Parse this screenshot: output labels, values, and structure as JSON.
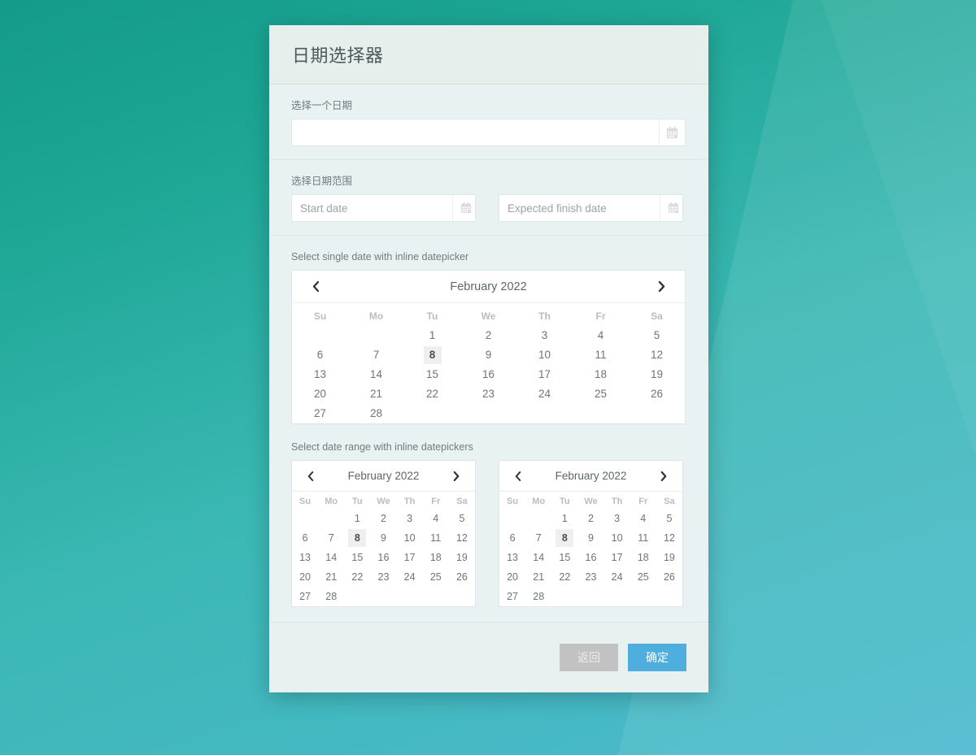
{
  "theme": {
    "bg_gradient_from": "#149b8a",
    "bg_gradient_to": "#4cb9cf",
    "modal_bg": "#e9f2f1",
    "header_bg": "#e7efed",
    "accent": "#4eaede",
    "muted_button": "#c2c2c2",
    "selected_day_bg": "#efefef"
  },
  "modal": {
    "title": "日期选择器"
  },
  "single_field": {
    "label": "选择一个日期",
    "value": "",
    "placeholder": "",
    "icon": "calendar-icon"
  },
  "range_field": {
    "label": "选择日期范围",
    "start": {
      "value": "",
      "placeholder": "Start date",
      "icon": "calendar-icon"
    },
    "end": {
      "value": "",
      "placeholder": "Expected finish date",
      "icon": "calendar-icon"
    }
  },
  "inline_single": {
    "label": "Select single date with inline datepicker",
    "picker": {
      "month_title": "February 2022",
      "prev_icon": "chevron-left-icon",
      "next_icon": "chevron-right-icon",
      "weekdays": [
        "Su",
        "Mo",
        "Tu",
        "We",
        "Th",
        "Fr",
        "Sa"
      ],
      "weeks": [
        [
          "",
          "",
          "1",
          "2",
          "3",
          "4",
          "5"
        ],
        [
          "6",
          "7",
          "8",
          "9",
          "10",
          "11",
          "12"
        ],
        [
          "13",
          "14",
          "15",
          "16",
          "17",
          "18",
          "19"
        ],
        [
          "20",
          "21",
          "22",
          "23",
          "24",
          "25",
          "26"
        ],
        [
          "27",
          "28",
          "",
          "",
          "",
          "",
          ""
        ]
      ],
      "selected": "8"
    }
  },
  "inline_range": {
    "label": "Select date range with inline datepickers",
    "start_picker": {
      "month_title": "February 2022",
      "prev_icon": "chevron-left-icon",
      "next_icon": "chevron-right-icon",
      "weekdays": [
        "Su",
        "Mo",
        "Tu",
        "We",
        "Th",
        "Fr",
        "Sa"
      ],
      "weeks": [
        [
          "",
          "",
          "1",
          "2",
          "3",
          "4",
          "5"
        ],
        [
          "6",
          "7",
          "8",
          "9",
          "10",
          "11",
          "12"
        ],
        [
          "13",
          "14",
          "15",
          "16",
          "17",
          "18",
          "19"
        ],
        [
          "20",
          "21",
          "22",
          "23",
          "24",
          "25",
          "26"
        ],
        [
          "27",
          "28",
          "",
          "",
          "",
          "",
          ""
        ]
      ],
      "selected": "8"
    },
    "end_picker": {
      "month_title": "February 2022",
      "prev_icon": "chevron-left-icon",
      "next_icon": "chevron-right-icon",
      "weekdays": [
        "Su",
        "Mo",
        "Tu",
        "We",
        "Th",
        "Fr",
        "Sa"
      ],
      "weeks": [
        [
          "",
          "",
          "1",
          "2",
          "3",
          "4",
          "5"
        ],
        [
          "6",
          "7",
          "8",
          "9",
          "10",
          "11",
          "12"
        ],
        [
          "13",
          "14",
          "15",
          "16",
          "17",
          "18",
          "19"
        ],
        [
          "20",
          "21",
          "22",
          "23",
          "24",
          "25",
          "26"
        ],
        [
          "27",
          "28",
          "",
          "",
          "",
          "",
          ""
        ]
      ],
      "selected": "8"
    }
  },
  "footer": {
    "back_label": "返回",
    "confirm_label": "确定"
  }
}
